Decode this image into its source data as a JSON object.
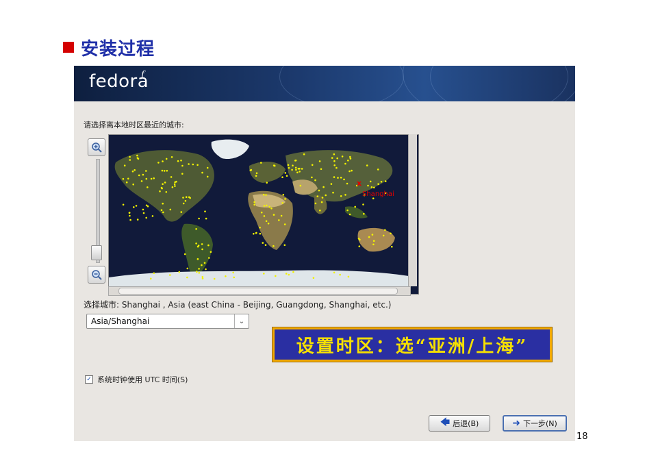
{
  "slide": {
    "title": "安装过程",
    "page_number": "18"
  },
  "installer": {
    "logo_text": "fedora",
    "logo_mark": "f",
    "prompt": "请选择离本地时区最近的城市:",
    "map": {
      "marked_city": "Shanghai"
    },
    "selected_city_text": "选择城市: Shanghai , Asia (east China - Beijing, Guangdong, Shanghai, etc.)",
    "timezone_select": "Asia/Shanghai",
    "utc_checkbox_label": "系统时钟使用 UTC 时间(S)",
    "utc_checked": true,
    "back_button": "后退(B)",
    "next_button": "下一步(N)"
  },
  "callout_text": "设置时区：选“亚洲/上海”",
  "colors": {
    "slide_title": "#1f2fa8",
    "bullet": "#d40000",
    "callout_bg": "#2a2fa2",
    "callout_text": "#f6e000",
    "callout_border": "#f0a800",
    "map_ocean": "#111a3a",
    "city_dot": "#f2f200",
    "marker": "#e00000"
  }
}
